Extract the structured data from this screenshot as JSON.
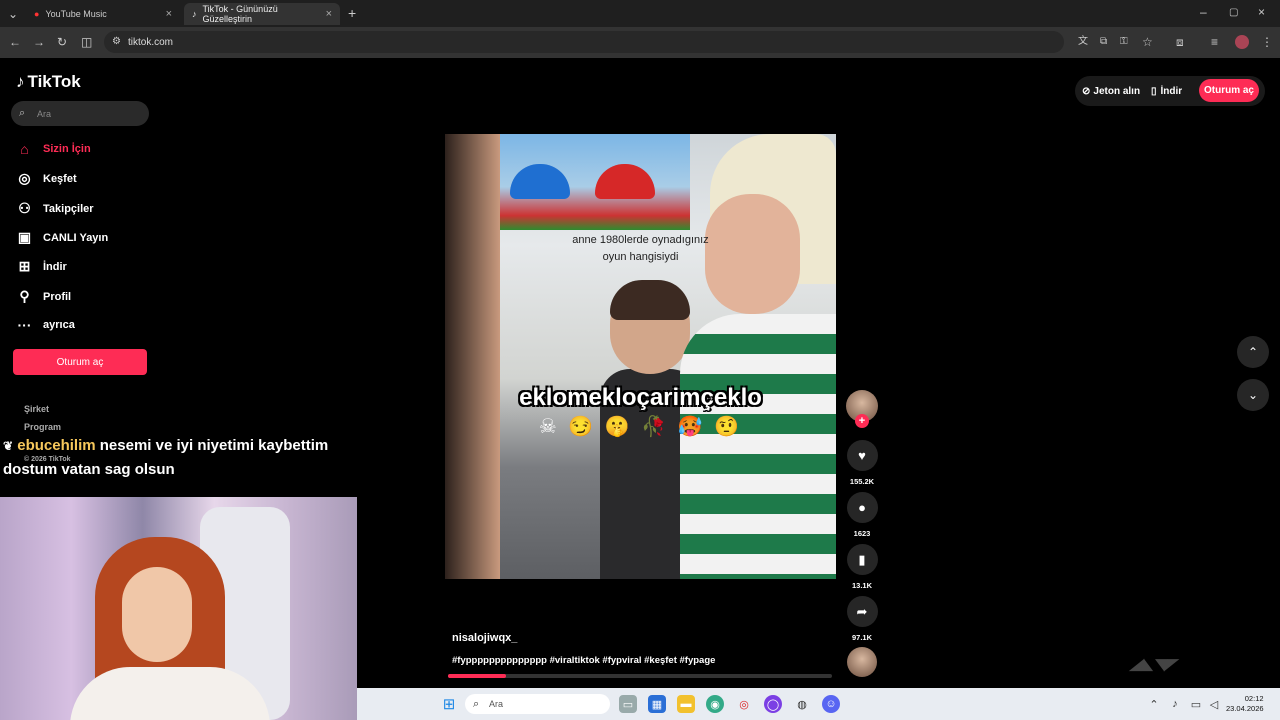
{
  "browser": {
    "tabs": [
      {
        "label": "YouTube Music",
        "active": false
      },
      {
        "label": "TikTok - Gününüzü Güzelleştirin",
        "active": true
      }
    ],
    "url": "tiktok.com"
  },
  "tiktok": {
    "brand": "TikTok",
    "search_placeholder": "Ara",
    "nav": [
      {
        "label": "Sizin İçin",
        "icon": "home-icon",
        "active": true
      },
      {
        "label": "Keşfet",
        "icon": "compass-icon",
        "active": false
      },
      {
        "label": "Takipçiler",
        "icon": "followers-icon",
        "active": false
      },
      {
        "label": "CANLI Yayın",
        "icon": "live-tv-icon",
        "active": false
      },
      {
        "label": "İndir",
        "icon": "download-icon",
        "active": false
      },
      {
        "label": "Profil",
        "icon": "profile-icon",
        "active": false
      },
      {
        "label": "ayrıca",
        "icon": "more-icon",
        "active": false
      }
    ],
    "login_button": "Oturum aç",
    "footer": [
      "Şirket",
      "Program",
      "© 2026 TikTok"
    ],
    "top_actions": {
      "coins": "Jeton alın",
      "download": "İndir",
      "login": "Oturum aç"
    },
    "video": {
      "caption_line1": "anne 1980lerde oynadıgınız",
      "caption_line2": "oyun hangisiydi",
      "overlay_text": "eklomekloçarimçeklo",
      "emoji_line": "☠ 😏 🤫 🥀 🥵 🤨",
      "author": "nisalojiwqx_",
      "hashtags": "#fypppppppppppppp #viraltiktok #fypviral #keşfet  #fypage",
      "progress_fraction": 0.15
    },
    "actions": {
      "likes": "155.2K",
      "comments": "1623",
      "saves": "13.1K",
      "shares": "97.1K"
    },
    "colors": {
      "accent": "#fe2c55"
    }
  },
  "stream_chat": {
    "username": "ebucehilim",
    "message_line1": "nesemi ve iyi niyetimi kaybettim",
    "message_line2": "dostum vatan sag olsun"
  },
  "taskbar": {
    "search_placeholder": "Ara",
    "time": "02:12",
    "date": "23.04.2026"
  }
}
